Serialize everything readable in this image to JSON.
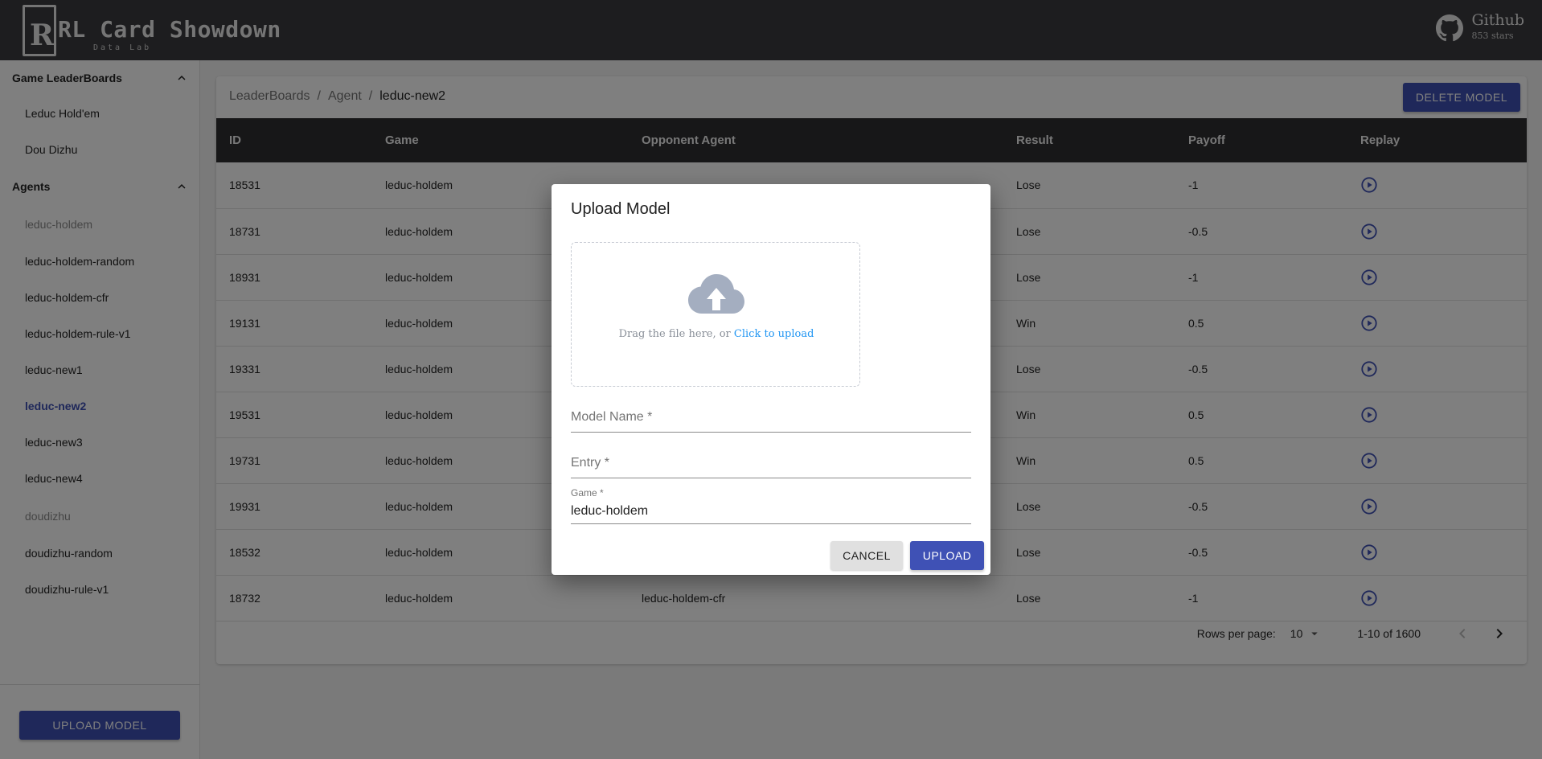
{
  "header": {
    "logo_glyph": "R",
    "app_title": "RL Card Showdown",
    "app_subtitle": "Data Lab",
    "github_label": "Github",
    "github_stars": "853 stars"
  },
  "sidebar": {
    "section_leaderboards": "Game LeaderBoards",
    "leaderboard_items": [
      "Leduc Hold'em",
      "Dou Dizhu"
    ],
    "section_agents": "Agents",
    "agent_items": [
      {
        "label": "leduc-holdem",
        "state": "muted"
      },
      {
        "label": "leduc-holdem-random",
        "state": "normal"
      },
      {
        "label": "leduc-holdem-cfr",
        "state": "normal"
      },
      {
        "label": "leduc-holdem-rule-v1",
        "state": "normal"
      },
      {
        "label": "leduc-new1",
        "state": "normal"
      },
      {
        "label": "leduc-new2",
        "state": "active"
      },
      {
        "label": "leduc-new3",
        "state": "normal"
      },
      {
        "label": "leduc-new4",
        "state": "normal"
      },
      {
        "label": "doudizhu",
        "state": "muted"
      },
      {
        "label": "doudizhu-random",
        "state": "normal"
      },
      {
        "label": "doudizhu-rule-v1",
        "state": "normal"
      }
    ],
    "upload_button": "UPLOAD MODEL"
  },
  "main": {
    "breadcrumb": [
      "LeaderBoards",
      "Agent",
      "leduc-new2"
    ],
    "breadcrumb_sep": "/",
    "delete_button": "DELETE MODEL",
    "table": {
      "headers": [
        "ID",
        "Game",
        "Opponent Agent",
        "Result",
        "Payoff",
        "Replay"
      ],
      "rows": [
        [
          "18531",
          "leduc-holdem",
          "",
          "Lose",
          "-1"
        ],
        [
          "18731",
          "leduc-holdem",
          "",
          "Lose",
          "-0.5"
        ],
        [
          "18931",
          "leduc-holdem",
          "",
          "Lose",
          "-1"
        ],
        [
          "19131",
          "leduc-holdem",
          "",
          "Win",
          "0.5"
        ],
        [
          "19331",
          "leduc-holdem",
          "",
          "Lose",
          "-0.5"
        ],
        [
          "19531",
          "leduc-holdem",
          "",
          "Win",
          "0.5"
        ],
        [
          "19731",
          "leduc-holdem",
          "",
          "Win",
          "0.5"
        ],
        [
          "19931",
          "leduc-holdem",
          "",
          "Lose",
          "-0.5"
        ],
        [
          "18532",
          "leduc-holdem",
          "",
          "Lose",
          "-0.5"
        ],
        [
          "18732",
          "leduc-holdem",
          "leduc-holdem-cfr",
          "Lose",
          "-1"
        ]
      ]
    },
    "pagination": {
      "rows_per_page_label": "Rows per page:",
      "rows_per_page_value": "10",
      "range": "1-10 of 1600"
    }
  },
  "dialog": {
    "title": "Upload Model",
    "drop_text": "Drag the file here, or",
    "drop_link": "Click to upload",
    "model_name_label": "Model Name *",
    "entry_label": "Entry *",
    "game_label": "Game *",
    "game_value": "leduc-holdem",
    "cancel_button": "CANCEL",
    "upload_button": "UPLOAD"
  },
  "colors": {
    "accent": "#3f51b5",
    "header_bg": "#3b3b3f",
    "table_header_bg": "#2e2e31",
    "link": "#2196f3"
  }
}
